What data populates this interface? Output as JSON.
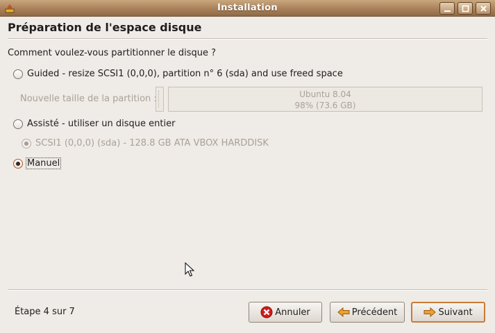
{
  "window": {
    "title": "Installation"
  },
  "page": {
    "title": "Préparation de l'espace disque",
    "question": "Comment voulez-vous partitionner le disque ?"
  },
  "options": {
    "guided": {
      "label": "Guided - resize SCSI1 (0,0,0), partition n° 6 (sda) and use freed space",
      "checked": false
    },
    "new_size_label": "Nouvelle taille de la partition :",
    "partition_bar": {
      "name": "Ubuntu 8.04",
      "size": "98% (73.6 GB)"
    },
    "entire": {
      "label": "Assisté - utiliser un disque entier",
      "checked": false
    },
    "disk": {
      "label": "SCSI1 (0,0,0) (sda) - 128.8 GB ATA VBOX HARDDISK",
      "checked": true,
      "enabled": false
    },
    "manual": {
      "label": "Manuel",
      "checked": true
    }
  },
  "footer": {
    "step": "Étape 4 sur 7",
    "cancel_label": "Annuler",
    "back_label": "Précédent",
    "next_label": "Suivant"
  },
  "icons": {
    "app": "installer-icon",
    "minimize": "minimize-icon",
    "maximize": "maximize-icon",
    "close": "close-icon",
    "cancel": "cancel-icon",
    "back": "arrow-left-icon",
    "next": "arrow-right-icon",
    "cursor": "mouse-pointer-icon"
  },
  "colors": {
    "titlebar": "#a9805a",
    "accent": "#c97a35",
    "background": "#efebe7"
  }
}
